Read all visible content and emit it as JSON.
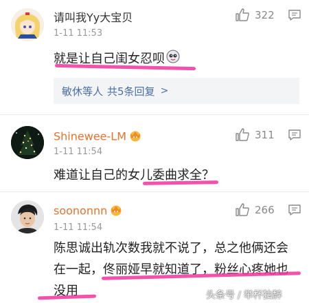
{
  "comments": [
    {
      "username": "请叫我Yy大宝贝",
      "time": "1-11 11:53",
      "likes": "322",
      "text_lines": [
        "就是让自己闺女忍呗"
      ],
      "replies": {
        "names": "敏休等人",
        "count": "共5条回复",
        "chevron": ">"
      }
    },
    {
      "username": "Shinewee-LM",
      "time": "1-11 11:54",
      "likes": "311",
      "text_lines": [
        "难道让自己的女儿委曲求全？"
      ]
    },
    {
      "username": "soononnn",
      "time": "1-11 11:54",
      "likes": "266",
      "text_lines": [
        "陈思诚出轨次数我就不说了，总之他俩还会",
        "在一起，佟丽娅早就知道了，粉丝心疼她也",
        "没用"
      ]
    }
  ],
  "watermark": {
    "source": "头条号",
    "author": "举杯独醉"
  },
  "colors": {
    "username_vip": "#e8712b",
    "reply_link": "#4a6fa5",
    "underline": "#f0339d",
    "timestamp": "#999999"
  },
  "icons": [
    "avatar",
    "thumbs-up-icon",
    "reply-icon",
    "vip-crown-badge-icon"
  ]
}
